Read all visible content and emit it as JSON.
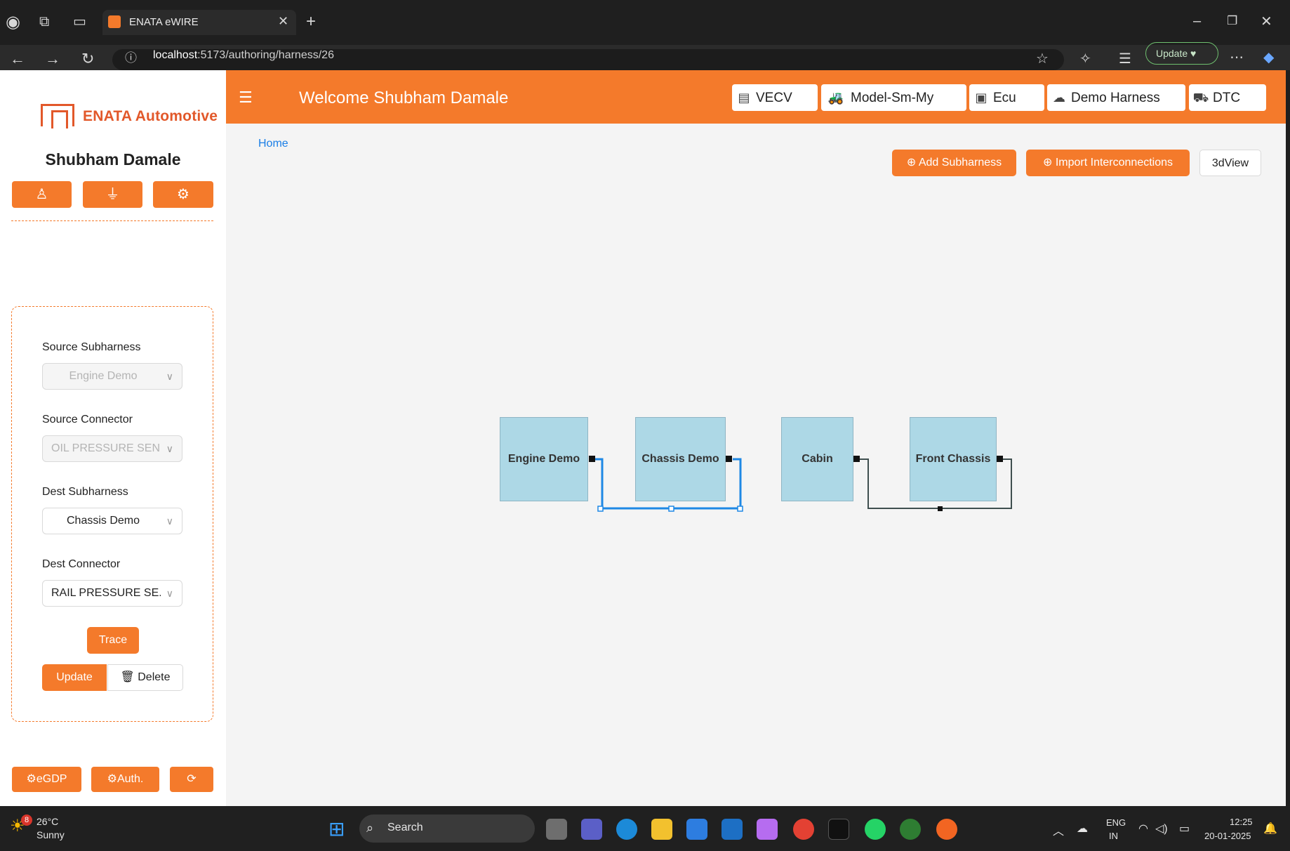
{
  "browser": {
    "tab_title": "ENATA eWIRE",
    "url_host": "localhost",
    "url_path": ":5173/authoring/harness/26",
    "update_label": "Update"
  },
  "sidebar": {
    "brand": "ENATA Automotive",
    "user_name": "Shubham Damale",
    "form": {
      "source_subharness_label": "Source Subharness",
      "source_subharness_value": "Engine Demo",
      "source_connector_label": "Source Connector",
      "source_connector_value": "OIL PRESSURE SEN...",
      "dest_subharness_label": "Dest Subharness",
      "dest_subharness_value": "Chassis Demo",
      "dest_connector_label": "Dest Connector",
      "dest_connector_value": "RAIL PRESSURE SE...",
      "trace_label": "Trace",
      "update_label": "Update",
      "delete_label": "Delete"
    },
    "bottom": {
      "egdp_label": "eGDP",
      "auth_label": "Auth."
    }
  },
  "header": {
    "welcome": "Welcome Shubham Damale",
    "nav": [
      "VECV",
      "Model-Sm-My",
      "Ecu",
      "Demo Harness",
      "DTC"
    ]
  },
  "main": {
    "breadcrumb": "Home",
    "add_subharness": "Add Subharness",
    "import_interconnections": "Import Interconnections",
    "view_3d": "3dView",
    "nodes": [
      "Engine Demo",
      "Chassis Demo",
      "Cabin",
      "Front Chassis"
    ]
  },
  "taskbar": {
    "weather_temp": "26°C",
    "weather_desc": "Sunny",
    "weather_badge": "8",
    "search_label": "Search",
    "lang_top": "ENG",
    "lang_bottom": "IN",
    "time": "12:25",
    "date": "20-01-2025"
  },
  "colors": {
    "accent": "#f47a2b",
    "node_fill": "#add8e6",
    "selected_edge": "#1e88e5",
    "edge": "#3f4f4f"
  }
}
